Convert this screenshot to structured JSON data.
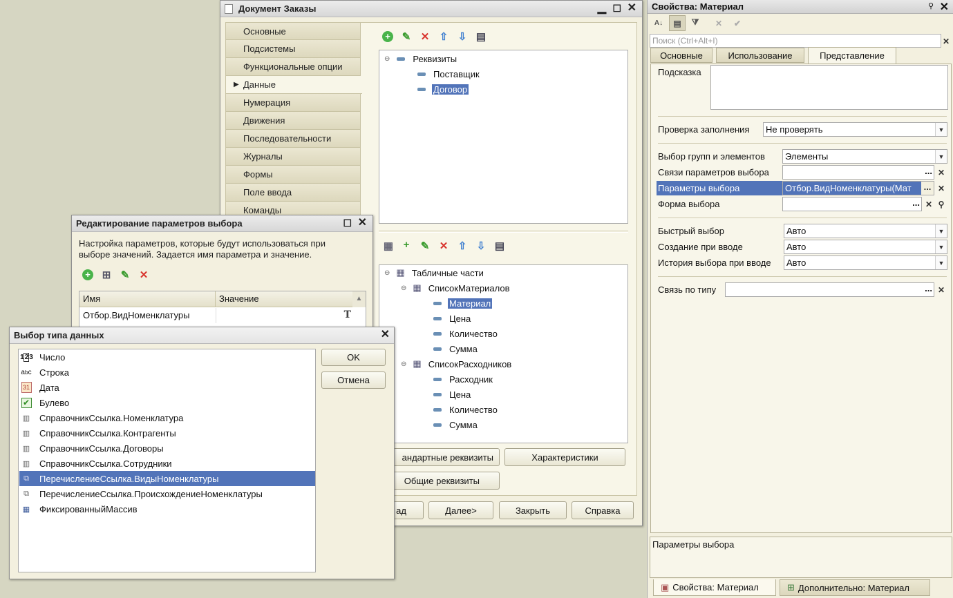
{
  "doc_window": {
    "title": "Документ Заказы",
    "nav": [
      "Основные",
      "Подсистемы",
      "Функциональные опции",
      "Данные",
      "Нумерация",
      "Движения",
      "Последовательности",
      "Журналы",
      "Формы",
      "Поле ввода",
      "Команды"
    ],
    "active_nav": "Данные",
    "attributes_tree": {
      "root": "Реквизиты",
      "items": [
        "Поставщик",
        "Договор"
      ],
      "selected": "Договор"
    },
    "tabular_tree": {
      "root": "Табличные части",
      "parts": [
        {
          "name": "СписокМатериалов",
          "items": [
            "Материал",
            "Цена",
            "Количество",
            "Сумма"
          ]
        },
        {
          "name": "СписокРасходников",
          "items": [
            "Расходник",
            "Цена",
            "Количество",
            "Сумма"
          ]
        }
      ],
      "selected": "Материал"
    },
    "buttons": {
      "standard_attrs": "андартные реквизиты",
      "characteristics": "Характеристики",
      "common_attrs": "Общие реквизиты",
      "back": "ад",
      "next": "Далее>",
      "close": "Закрыть",
      "help": "Справка"
    }
  },
  "params_window": {
    "title": "Редактирование параметров выбора",
    "description": "Настройка параметров, которые будут использоваться при выборе значений. Задается имя параметра и значение.",
    "columns": [
      "Имя",
      "Значение"
    ],
    "rows": [
      {
        "name": "Отбор.ВидНоменклатуры",
        "value": ""
      }
    ]
  },
  "type_window": {
    "title": "Выбор типа данных",
    "ok": "OK",
    "cancel": "Отмена",
    "types": [
      {
        "label": "Число",
        "icon": "number-icon"
      },
      {
        "label": "Строка",
        "icon": "string-icon"
      },
      {
        "label": "Дата",
        "icon": "calendar-icon"
      },
      {
        "label": "Булево",
        "icon": "checkbox-icon"
      },
      {
        "label": "СправочникСсылка.Номенклатура",
        "icon": "catalog-icon"
      },
      {
        "label": "СправочникСсылка.Контрагенты",
        "icon": "catalog-icon"
      },
      {
        "label": "СправочникСсылка.Договоры",
        "icon": "catalog-icon"
      },
      {
        "label": "СправочникСсылка.Сотрудники",
        "icon": "catalog-icon"
      },
      {
        "label": "ПеречислениеСсылка.ВидыНоменклатуры",
        "icon": "enum-icon"
      },
      {
        "label": "ПеречислениеСсылка.ПроисхождениеНоменклатуры",
        "icon": "enum-icon"
      },
      {
        "label": "ФиксированныйМассив",
        "icon": "array-icon"
      }
    ],
    "selected": "ПеречислениеСсылка.ВидыНоменклатуры"
  },
  "props_window": {
    "title": "Свойства: Материал",
    "search_placeholder": "Поиск (Ctrl+Alt+I)",
    "tabs": [
      "Основные",
      "Использование",
      "Представление"
    ],
    "active_tab": "Представление",
    "fields": {
      "hint_label": "Подсказка",
      "fill_check_label": "Проверка заполнения",
      "fill_check_value": "Не проверять",
      "choose_groups_label": "Выбор групп и элементов",
      "choose_groups_value": "Элементы",
      "links_label": "Связи параметров выбора",
      "links_value": "",
      "params_label": "Параметры выбора",
      "params_value": "Отбор.ВидНоменклатуры(Мат",
      "form_label": "Форма выбора",
      "form_value": "",
      "quick_label": "Быстрый выбор",
      "quick_value": "Авто",
      "create_label": "Создание при вводе",
      "create_value": "Авто",
      "history_label": "История выбора при вводе",
      "history_value": "Авто",
      "type_link_label": "Связь по типу",
      "type_link_value": ""
    },
    "description": "Параметры выбора",
    "bottom_tabs": [
      "Свойства: Материал",
      "Дополнительно: Материал"
    ]
  },
  "colors": {
    "selection": "#5274b9",
    "window_bg": "#f3f0df",
    "desktop": "#d6d6c2"
  }
}
